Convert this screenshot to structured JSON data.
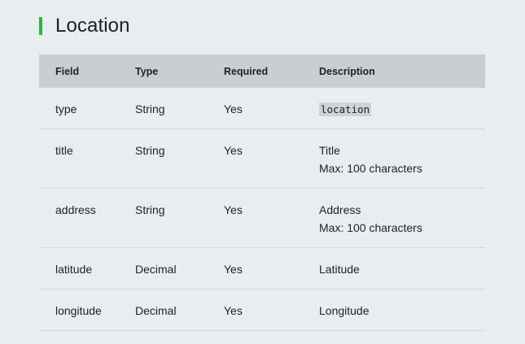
{
  "section": {
    "title": "Location",
    "accent_color": "#1fbd2e"
  },
  "table": {
    "headers": [
      "Field",
      "Type",
      "Required",
      "Description"
    ],
    "rows": [
      {
        "field": "type",
        "type": "String",
        "required": "Yes",
        "description": "location",
        "description_is_code": true,
        "note": ""
      },
      {
        "field": "title",
        "type": "String",
        "required": "Yes",
        "description": "Title",
        "note": "Max: 100 characters"
      },
      {
        "field": "address",
        "type": "String",
        "required": "Yes",
        "description": "Address",
        "note": "Max: 100 characters"
      },
      {
        "field": "latitude",
        "type": "Decimal",
        "required": "Yes",
        "description": "Latitude",
        "note": ""
      },
      {
        "field": "longitude",
        "type": "Decimal",
        "required": "Yes",
        "description": "Longitude",
        "note": ""
      }
    ]
  }
}
